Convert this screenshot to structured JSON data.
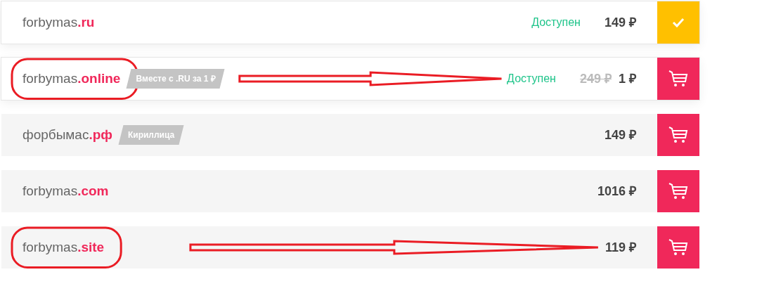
{
  "domains": [
    {
      "domain": "forbymas**.ru**",
      "highlighted": true,
      "status": "Доступен",
      "price": "149 ₽",
      "added": true,
      "circled": false,
      "arrow": false
    },
    {
      "domain": "forbymas**.online**",
      "highlighted": true,
      "badge": "Вместе с .RU за 1 ₽",
      "status": "Доступен",
      "old_price": "249 ₽",
      "price": "1 ₽",
      "added": false,
      "circled": true,
      "arrow": true
    },
    {
      "domain": "форбымас**.рф**",
      "highlighted": false,
      "badge": "Кириллица",
      "price": "149 ₽",
      "added": false,
      "circled": false,
      "arrow": false
    },
    {
      "domain": "forbymas**.com**",
      "highlighted": false,
      "price": "1016 ₽",
      "added": false,
      "circled": false,
      "arrow": false
    },
    {
      "domain": "forbymas**.site**",
      "highlighted": false,
      "price": "119 ₽",
      "added": false,
      "circled": true,
      "arrow": true
    }
  ]
}
